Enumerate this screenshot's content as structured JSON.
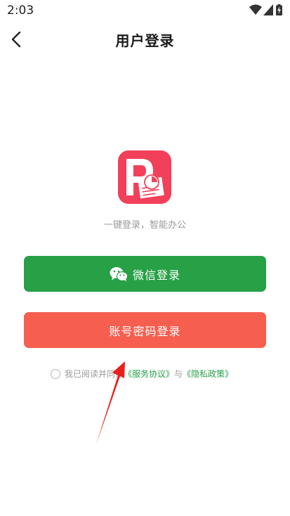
{
  "status_bar": {
    "time": "2:03",
    "icons": [
      "wifi-icon",
      "cellular-signal-icon",
      "battery-charging-icon"
    ]
  },
  "header": {
    "title": "用户登录",
    "back_icon": "chevron-left-icon"
  },
  "app": {
    "logo_icon": "app-logo-icon",
    "slogan": "一键登录，智能办公"
  },
  "buttons": {
    "wechat_label": "微信登录",
    "account_label": "账号密码登录"
  },
  "agreement": {
    "prefix": "我已阅读并同意",
    "service_link": "《服务协议》",
    "joiner": "与",
    "privacy_link": "《隐私政策》"
  },
  "colors": {
    "wechat_green": "#27a046",
    "account_red": "#f65f50",
    "logo_red": "#f2405a"
  }
}
